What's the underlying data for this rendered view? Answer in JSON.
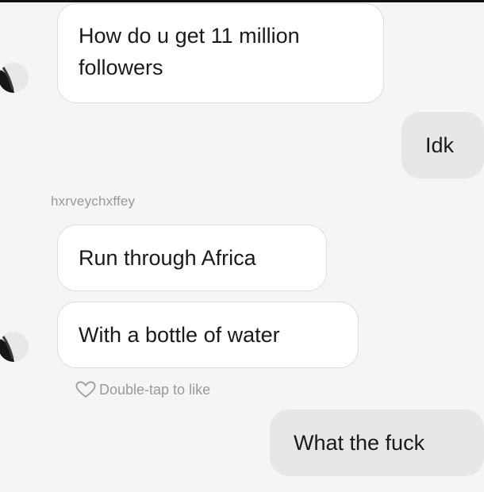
{
  "conversation": {
    "messages": [
      {
        "direction": "incoming",
        "text": "How do u get 11 million followers"
      },
      {
        "direction": "outgoing",
        "text": "Idk"
      },
      {
        "direction": "incoming",
        "text": "Run through Africa"
      },
      {
        "direction": "incoming",
        "text": "With a bottle of water"
      },
      {
        "direction": "outgoing",
        "text": "What the fuck"
      }
    ],
    "sender_name": "hxrveychxffey",
    "like_hint": "Double-tap to like",
    "icons": {
      "avatar": "profile-avatar",
      "like": "heart-outline-icon"
    }
  }
}
